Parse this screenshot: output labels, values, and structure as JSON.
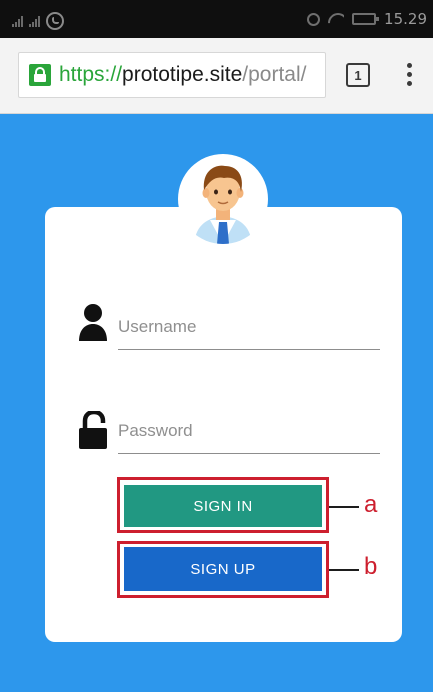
{
  "status_bar": {
    "time": "15.29",
    "icons": [
      "signal-icon",
      "whatsapp-icon",
      "alarm-icon",
      "wifi-icon",
      "battery-icon"
    ]
  },
  "browser": {
    "url_scheme": "https://",
    "url_host": "prototipe.site",
    "url_path": "/portal/",
    "tab_count": "1",
    "secure_color": "#2aa53a"
  },
  "login": {
    "username_placeholder": "Username",
    "password_placeholder": "Password",
    "signin_label": "SIGN IN",
    "signup_label": "SIGN UP",
    "signin_color": "#219882",
    "signup_color": "#1868c9",
    "background_color": "#2d97ec"
  },
  "annotations": {
    "label_a": "a",
    "label_b": "b",
    "highlight_color": "#cd1f2e"
  }
}
